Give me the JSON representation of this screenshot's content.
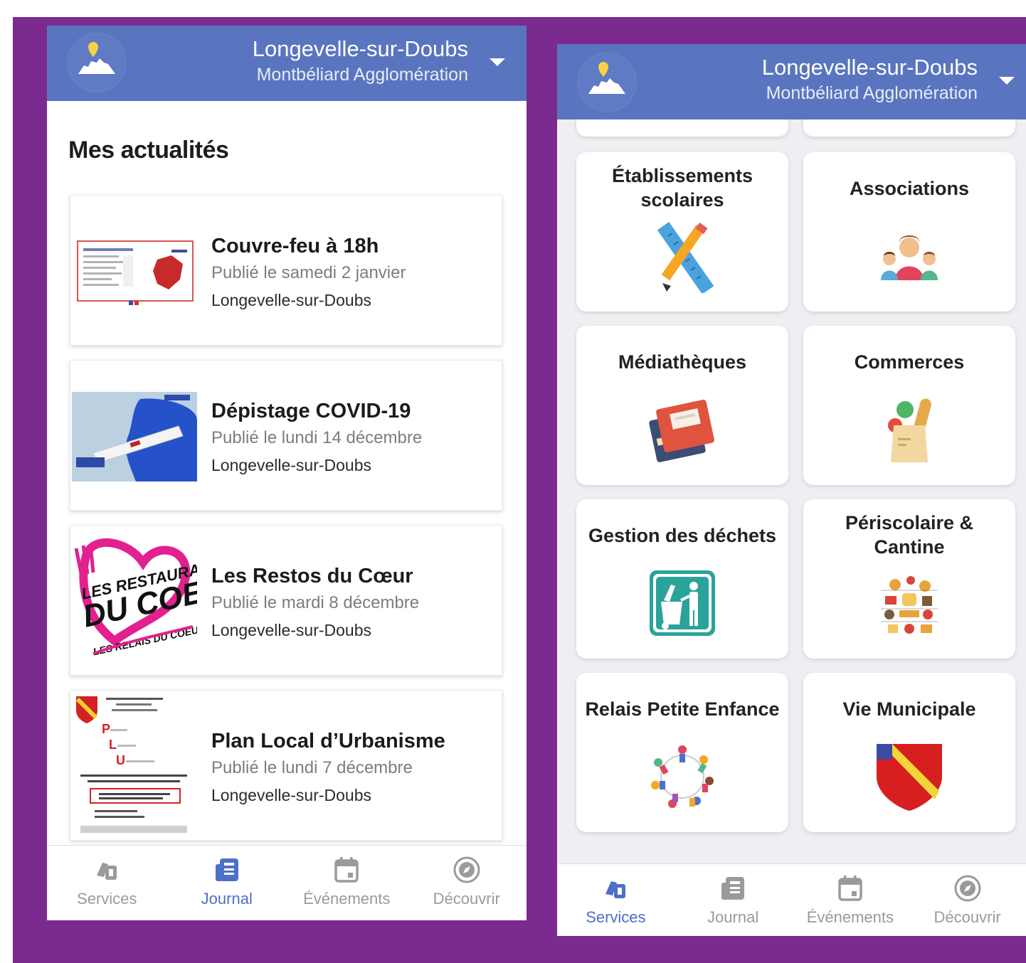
{
  "colors": {
    "frame": "#7b2a8f",
    "header": "#5a75bf",
    "accent": "#4d6fc7"
  },
  "header": {
    "city": "Longevelle-sur-Doubs",
    "agglomeration": "Montbéliard Agglomération",
    "logo_icon": "map-pin-landmark-icon",
    "dropdown_icon": "caret-down-icon"
  },
  "journal": {
    "title": "Mes actualités",
    "items": [
      {
        "title": "Couvre-feu à 18h",
        "date": "Publié le samedi 2 janvier",
        "place": "Longevelle-sur-Doubs",
        "thumb": "curfew-document-thumbnail"
      },
      {
        "title": "Dépistage COVID-19",
        "date": "Publié le lundi 14 décembre",
        "place": "Longevelle-sur-Doubs",
        "thumb": "covid-test-thumbnail"
      },
      {
        "title": "Les Restos du Cœur",
        "date": "Publié le mardi 8 décembre",
        "place": "Longevelle-sur-Doubs",
        "thumb": "restos-du-coeur-logo"
      },
      {
        "title": "Plan Local d’Urbanisme",
        "date": "Publié le lundi 7 décembre",
        "place": "Longevelle-sur-Doubs",
        "thumb": "urban-plan-document-thumbnail"
      }
    ]
  },
  "services": {
    "tiles": [
      {
        "label": "Établissements scolaires",
        "icon": "ruler-pencil-icon"
      },
      {
        "label": "Associations",
        "icon": "people-group-icon"
      },
      {
        "label": "Médiathèques",
        "icon": "books-icon"
      },
      {
        "label": "Commerces",
        "icon": "grocery-bag-icon"
      },
      {
        "label": "Gestion des déchets",
        "icon": "waste-bin-icon"
      },
      {
        "label": "Périscolaire & Cantine",
        "icon": "food-icon"
      },
      {
        "label": "Relais Petite Enfance",
        "icon": "children-circle-icon"
      },
      {
        "label": "Vie Municipale",
        "icon": "coat-of-arms-icon"
      }
    ]
  },
  "tabs": [
    {
      "label": "Services",
      "icon": "services-icon"
    },
    {
      "label": "Journal",
      "icon": "journal-icon"
    },
    {
      "label": "Événements",
      "icon": "calendar-icon"
    },
    {
      "label": "Découvrir",
      "icon": "compass-icon"
    }
  ],
  "left_active_tab": "Journal",
  "right_active_tab": "Services"
}
